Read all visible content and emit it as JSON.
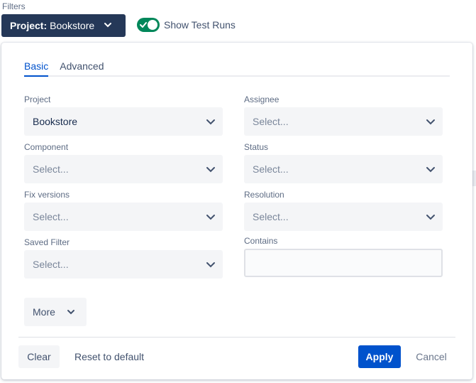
{
  "header": {
    "filters_label": "Filters",
    "project_prefix": "Project:",
    "project_value": "Bookstore",
    "show_test_runs_label": "Show Test Runs",
    "show_test_runs_on": true
  },
  "tabs": [
    {
      "label": "Basic",
      "active": true
    },
    {
      "label": "Advanced",
      "active": false
    }
  ],
  "fields": {
    "project": {
      "label": "Project",
      "value": "Bookstore"
    },
    "assignee": {
      "label": "Assignee",
      "placeholder": "Select..."
    },
    "component": {
      "label": "Component",
      "placeholder": "Select..."
    },
    "status": {
      "label": "Status",
      "placeholder": "Select..."
    },
    "fix_versions": {
      "label": "Fix versions",
      "placeholder": "Select..."
    },
    "resolution": {
      "label": "Resolution",
      "placeholder": "Select..."
    },
    "saved_filter": {
      "label": "Saved Filter",
      "placeholder": "Select..."
    },
    "contains": {
      "label": "Contains",
      "value": ""
    }
  },
  "more_label": "More",
  "footer": {
    "clear_label": "Clear",
    "reset_label": "Reset to default",
    "apply_label": "Apply",
    "cancel_label": "Cancel"
  },
  "colors": {
    "project_button_bg": "#253858",
    "toggle_on": "#00875a",
    "accent": "#0052cc"
  }
}
